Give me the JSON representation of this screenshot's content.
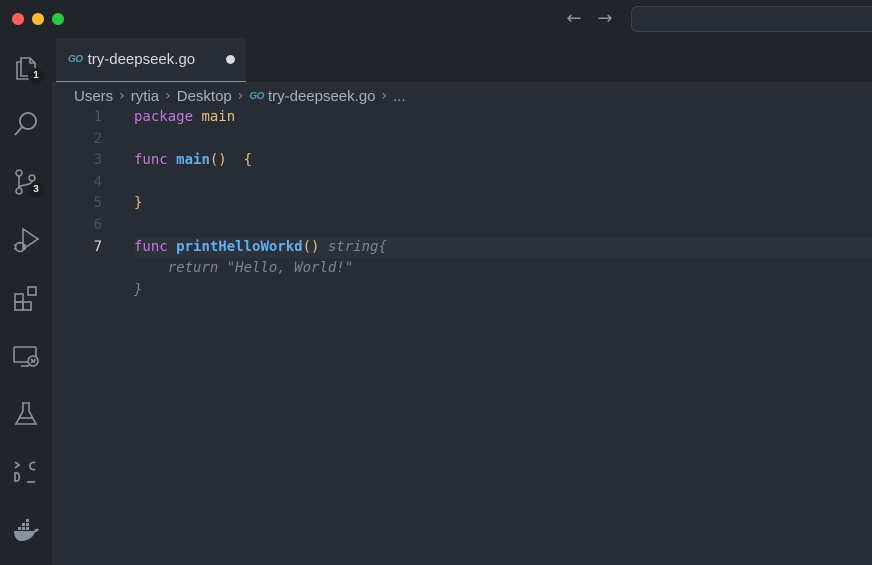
{
  "window": {
    "nav_back": "←",
    "nav_forward": "→"
  },
  "activity_bar": {
    "explorer_badge": "1",
    "source_control_badge": "3",
    "icons": [
      "files-icon",
      "search-icon",
      "source-control-icon",
      "run-debug-icon",
      "extensions-icon",
      "remote-explorer-icon",
      "testing-icon",
      "codegpt-icon",
      "docker-icon"
    ]
  },
  "tab": {
    "icon_text": "GO",
    "label": "try-deepseek.go"
  },
  "breadcrumb": {
    "items": [
      "Users",
      "rytia",
      "Desktop"
    ],
    "file_icon_text": "GO",
    "file": "try-deepseek.go",
    "more": "..."
  },
  "editor": {
    "line_numbers": [
      "1",
      "2",
      "3",
      "4",
      "5",
      "6",
      "7"
    ],
    "line1": {
      "kw": "package",
      "name": "main"
    },
    "line3": {
      "kw": "func",
      "fn": "main",
      "parens": "()",
      "brace": "{"
    },
    "line5": {
      "brace": "}"
    },
    "line7": {
      "kw": "func",
      "fn": "printHelloWorkd",
      "parens": "()",
      "ghost": " string{"
    },
    "ghost_line8": "    return \"Hello, World!\"",
    "ghost_line9": "}"
  },
  "colors": {
    "background": "#282c34",
    "keyword": "#c678dd",
    "function": "#61afef",
    "go_icon": "#519aba"
  }
}
